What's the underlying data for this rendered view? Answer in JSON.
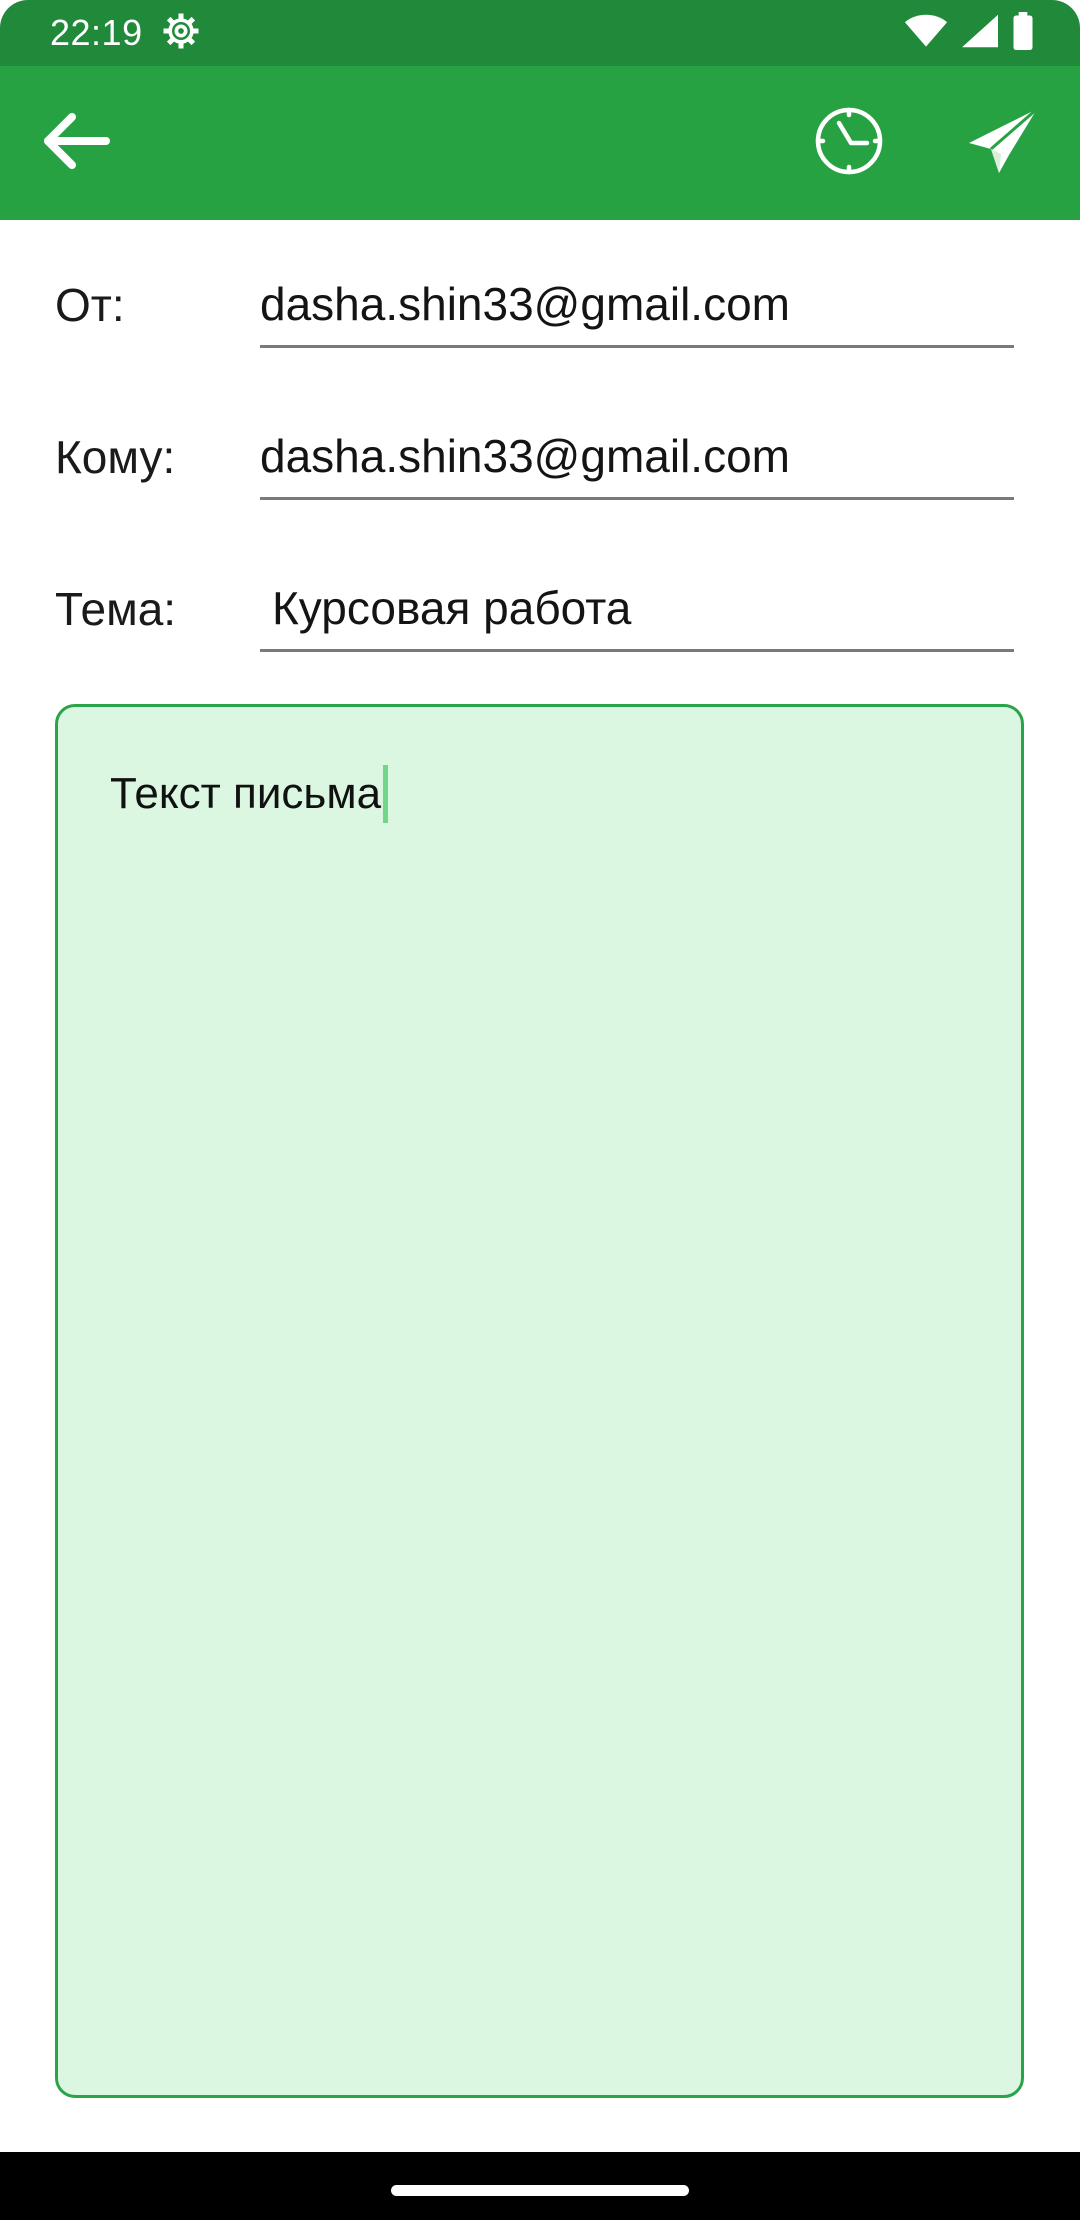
{
  "status_bar": {
    "time": "22:19",
    "icons": [
      "settings-gear-icon",
      "wifi-icon",
      "cellular-signal-icon",
      "battery-icon"
    ]
  },
  "app_bar": {
    "color": "#27a243",
    "actions": [
      "back-arrow-icon",
      "schedule-clock-icon",
      "send-paper-plane-icon"
    ]
  },
  "form": {
    "from": {
      "label": "От:",
      "value": "dasha.shin33@gmail.com"
    },
    "to": {
      "label": "Кому:",
      "value": "dasha.shin33@gmail.com"
    },
    "subject": {
      "label": "Тема:",
      "value": "Курсовая работа"
    },
    "body": {
      "value": "Текст письма"
    }
  },
  "colors": {
    "status_bar": "#208a3a",
    "app_bar": "#27a243",
    "body_background": "#dbf7e2",
    "body_border": "#2aa44a"
  }
}
